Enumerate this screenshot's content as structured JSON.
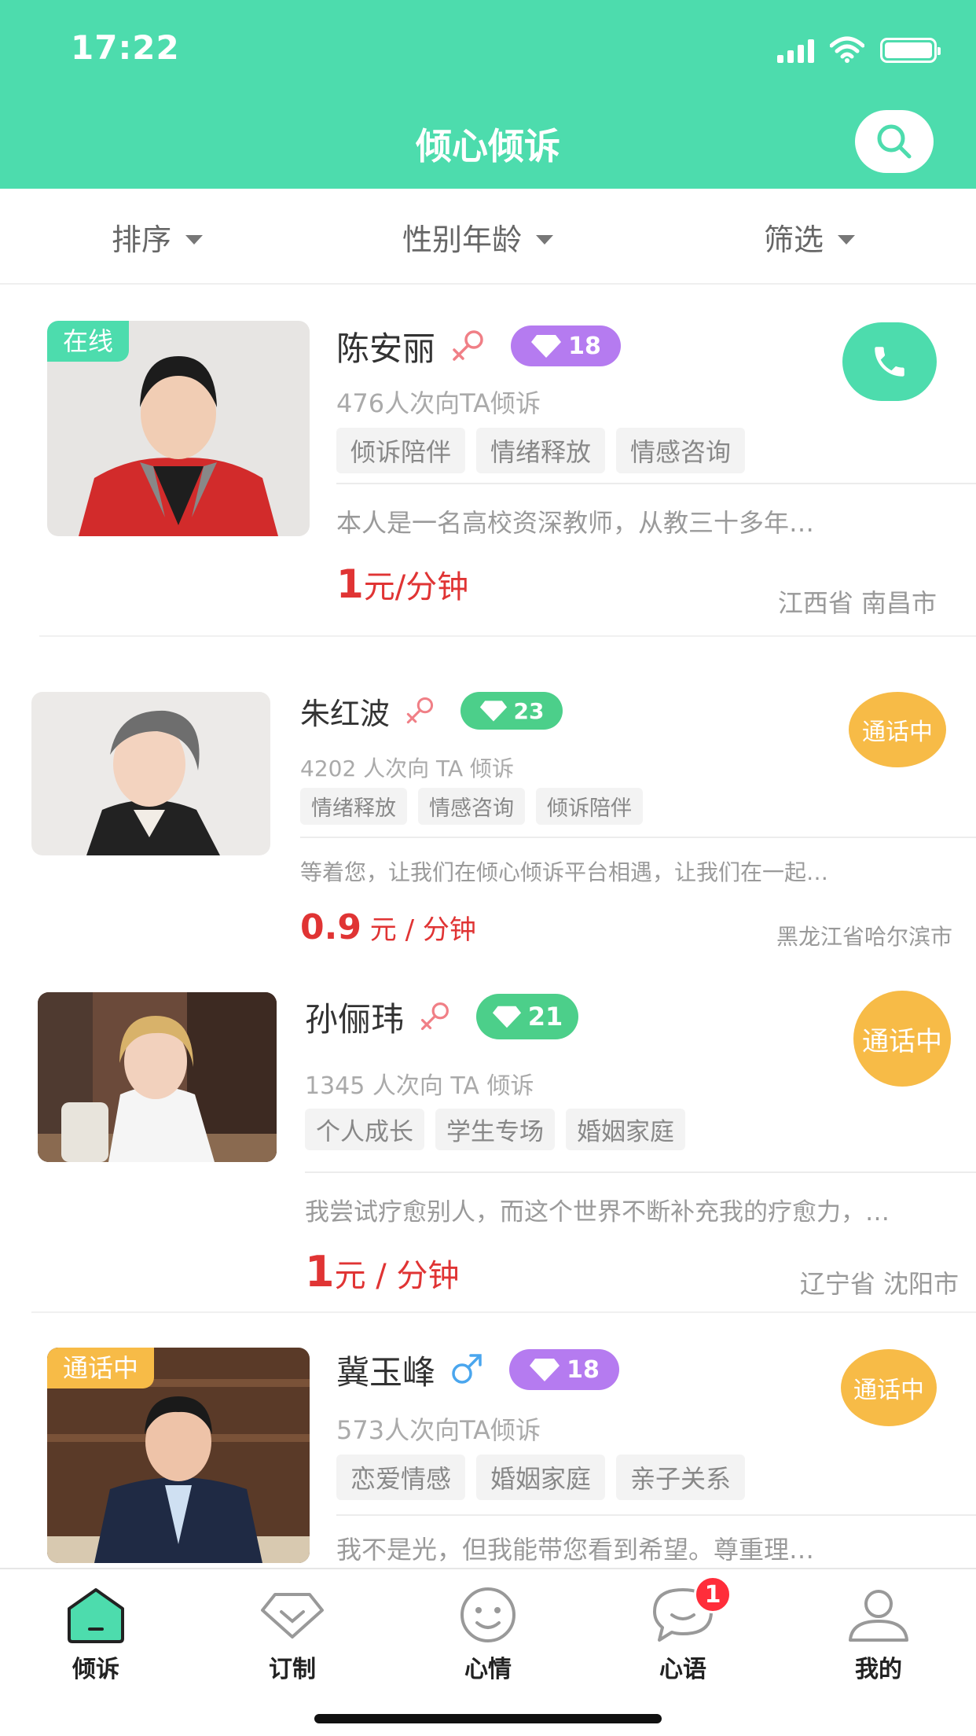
{
  "status_bar": {
    "time": "17:22"
  },
  "header": {
    "title": "倾心倾诉",
    "search_icon": "search-icon"
  },
  "filters": [
    {
      "label": "排序"
    },
    {
      "label": "性别年龄"
    },
    {
      "label": "筛选"
    }
  ],
  "listeners": [
    {
      "name": "陈安丽",
      "gender": "female",
      "level": "18",
      "level_color": "#b57bf0",
      "photo_badge": "在线",
      "photo_badge_color": "#4ddcad",
      "count": "476人次向TA倾诉",
      "tags": [
        "倾诉陪伴",
        "情绪释放",
        "情感咨询"
      ],
      "desc": "本人是一名高校资深教师，从教三十多年…",
      "price_num": "1",
      "price_unit": "元/分钟",
      "location": "江西省 南昌市",
      "action": "phone-call",
      "action_color": "#4ddcad"
    },
    {
      "name": "朱红波",
      "gender": "female",
      "level": "23",
      "level_color": "#4ccf8a",
      "count": "4202 人次向 TA 倾诉",
      "tags": [
        "情绪释放",
        "情感咨询",
        "倾诉陪伴"
      ],
      "desc": "等着您，让我们在倾心倾诉平台相遇，让我们在一起…",
      "price_num": "0.9",
      "price_unit": " 元 / 分钟",
      "location": "黑龙江省哈尔滨市",
      "action": "通话中",
      "action_color": "#f7bb47"
    },
    {
      "name": "孙俪玮",
      "gender": "female",
      "level": "21",
      "level_color": "#4ccf8a",
      "count": "1345 人次向 TA 倾诉",
      "tags": [
        "个人成长",
        "学生专场",
        "婚姻家庭"
      ],
      "desc": "我尝试疗愈别人，而这个世界不断补充我的疗愈力，…",
      "price_num": "1",
      "price_unit": "元 / 分钟",
      "location": "辽宁省 沈阳市",
      "action": "通话中",
      "action_color": "#f7bb47"
    },
    {
      "name": "冀玉峰",
      "gender": "male",
      "level": "18",
      "level_color": "#b57bf0",
      "photo_badge": "通话中",
      "photo_badge_color": "#f7bb47",
      "count": "573人次向TA倾诉",
      "tags": [
        "恋爱情感",
        "婚姻家庭",
        "亲子关系"
      ],
      "desc": "我不是光，但我能带您看到希望。尊重理…",
      "action": "通话中",
      "action_color": "#f7bb47"
    }
  ],
  "tabbar": [
    {
      "label": "倾诉",
      "icon": "home-icon",
      "active": true
    },
    {
      "label": "订制",
      "icon": "diamond-icon"
    },
    {
      "label": "心情",
      "icon": "smile-icon"
    },
    {
      "label": "心语",
      "icon": "chat-bubble-icon",
      "badge": "1"
    },
    {
      "label": "我的",
      "icon": "person-icon"
    }
  ]
}
